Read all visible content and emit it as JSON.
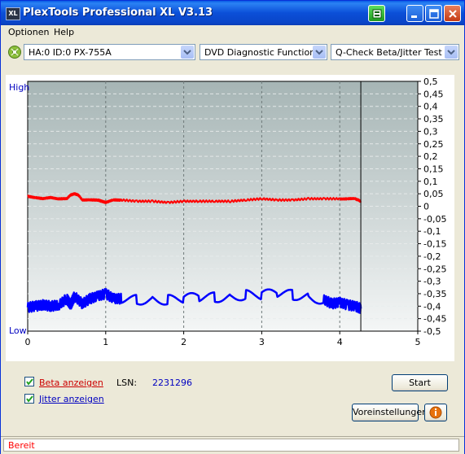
{
  "window": {
    "title": "PlexTools Professional XL V3.13",
    "app_icon_text": "XL"
  },
  "menu": {
    "items": [
      "Optionen",
      "Help"
    ]
  },
  "toolbar": {
    "drive": "HA:0 ID:0  PX-755A",
    "function": "DVD Diagnostic Functions",
    "test": "Q-Check Beta/Jitter Test"
  },
  "chart_data": {
    "type": "line",
    "title": "",
    "xlabel": "",
    "ylabel_left": "",
    "ylabel_right": "",
    "left_axis_labels": [
      "High",
      "Low"
    ],
    "x_ticks": [
      "0",
      "1",
      "2",
      "3",
      "4",
      "5"
    ],
    "xlim": [
      0,
      5
    ],
    "y_right_ticks": [
      "0,5",
      "0,45",
      "0,4",
      "0,35",
      "0,3",
      "0,25",
      "0,2",
      "0,15",
      "0,1",
      "0,05",
      "0",
      "-0,05",
      "-0,1",
      "-0,15",
      "-0,2",
      "-0,25",
      "-0,3",
      "-0,35",
      "-0,4",
      "-0,45",
      "-0,5"
    ],
    "ylim": [
      -0.5,
      0.5
    ],
    "grid": true,
    "end_marker_x": 4.27,
    "series": [
      {
        "color": "#ff0000",
        "x": [
          0.0,
          0.1,
          0.2,
          0.3,
          0.4,
          0.5,
          0.55,
          0.6,
          0.65,
          0.7,
          0.8,
          0.9,
          0.95,
          1.0,
          1.1,
          1.2,
          1.4,
          1.6,
          1.8,
          2.0,
          2.2,
          2.4,
          2.6,
          2.8,
          3.0,
          3.2,
          3.4,
          3.6,
          3.8,
          4.0,
          4.1,
          4.2,
          4.27
        ],
        "values": [
          0.04,
          0.035,
          0.03,
          0.035,
          0.03,
          0.03,
          0.045,
          0.05,
          0.045,
          0.025,
          0.025,
          0.025,
          0.02,
          0.015,
          0.025,
          0.025,
          0.02,
          0.02,
          0.015,
          0.02,
          0.02,
          0.02,
          0.02,
          0.025,
          0.03,
          0.025,
          0.025,
          0.03,
          0.03,
          0.03,
          0.03,
          0.03,
          0.02
        ]
      },
      {
        "color": "#0000ff",
        "x": [
          0.0,
          0.1,
          0.2,
          0.3,
          0.4,
          0.5,
          0.55,
          0.6,
          0.7,
          0.8,
          0.9,
          1.0,
          1.1,
          1.2,
          1.4,
          1.6,
          1.8,
          2.0,
          2.2,
          2.4,
          2.6,
          2.8,
          3.0,
          3.2,
          3.4,
          3.6,
          3.8,
          3.9,
          4.0,
          4.1,
          4.2,
          4.27
        ],
        "values": [
          -0.405,
          -0.4,
          -0.395,
          -0.4,
          -0.395,
          -0.37,
          -0.395,
          -0.36,
          -0.39,
          -0.37,
          -0.36,
          -0.35,
          -0.37,
          -0.37,
          -0.375,
          -0.37,
          -0.375,
          -0.37,
          -0.365,
          -0.365,
          -0.36,
          -0.355,
          -0.355,
          -0.35,
          -0.355,
          -0.36,
          -0.375,
          -0.39,
          -0.385,
          -0.395,
          -0.4,
          -0.41
        ]
      }
    ]
  },
  "options": {
    "beta_label": "Beta anzeigen",
    "jitter_label": "Jitter anzeigen",
    "beta_checked": true,
    "jitter_checked": true,
    "lsn_label": "LSN:",
    "lsn_value": "2231296",
    "start_label": "Start",
    "settings_label": "Voreinstellungen",
    "info_icon": "info-icon"
  },
  "status": {
    "text": "Bereit"
  },
  "colors": {
    "chart_bg_top": "#a6b5b5",
    "chart_bg_bottom": "#f4f6f6",
    "beta_color": "#ff0000",
    "jitter_color": "#0000ff",
    "high_low_color": "#0000c0",
    "lsn_value_color": "#0000c0",
    "status_color": "#ff0000"
  }
}
